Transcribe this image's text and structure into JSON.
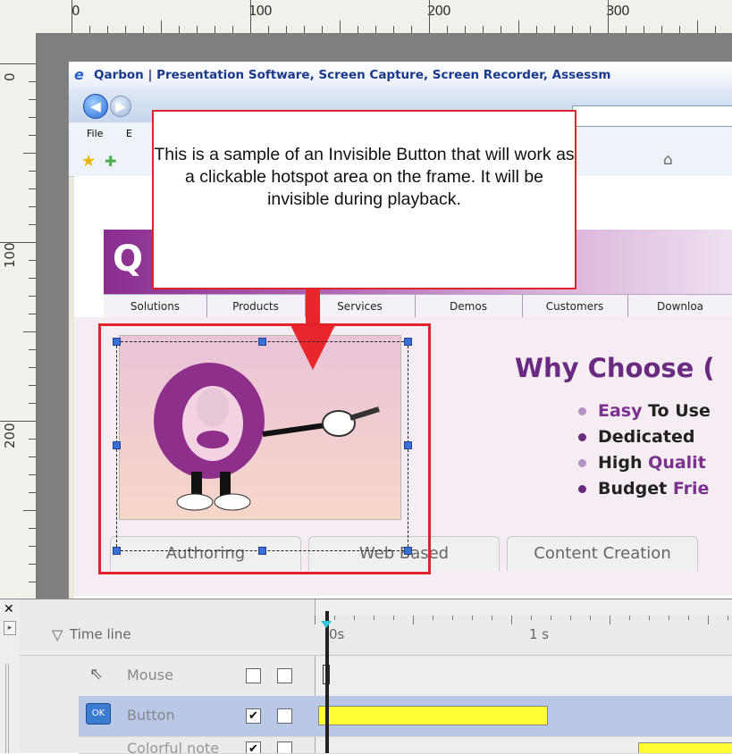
{
  "ruler": {
    "h_labels": [
      "0",
      "100",
      "200",
      "300"
    ],
    "v_labels": [
      "0",
      "100",
      "200"
    ]
  },
  "browser": {
    "title": "Qarbon | Presentation Software, Screen Capture, Screen Recorder, Assessm",
    "menu": [
      "File",
      "E"
    ],
    "nav_tabs": [
      "Solutions",
      "Products",
      "Services",
      "Demos",
      "Customers",
      "Downloa"
    ],
    "logo_letter": "Q",
    "heading": "Why Choose (",
    "bullets": [
      {
        "a": "Easy",
        "b": "To Use"
      },
      {
        "a": "Dedicated",
        "b": ""
      },
      {
        "a": "High",
        "b": "Qualit"
      },
      {
        "a": "Budget",
        "b": "Frie"
      }
    ],
    "bottom_tabs": [
      "Authoring",
      "Web Based",
      "Content Creation"
    ]
  },
  "callout": {
    "text": "This is a sample of an Invisible Button that will work as a clickable hotspot area on the frame. It will be invisible during playback."
  },
  "timeline": {
    "title": "Time line",
    "time_marks": [
      "0s",
      "1 s"
    ],
    "rows": [
      {
        "label": "Mouse",
        "checked1": "",
        "checked2": ""
      },
      {
        "label": "Button",
        "checked1": "✔",
        "checked2": ""
      },
      {
        "label": "Colorful note",
        "checked1": "✔",
        "checked2": ""
      }
    ]
  },
  "colors": {
    "callout_border": "#e0232a",
    "selection_handle": "#3b6fd4",
    "timeline_bar": "#ffff33",
    "selected_row": "#b9c8e6"
  }
}
